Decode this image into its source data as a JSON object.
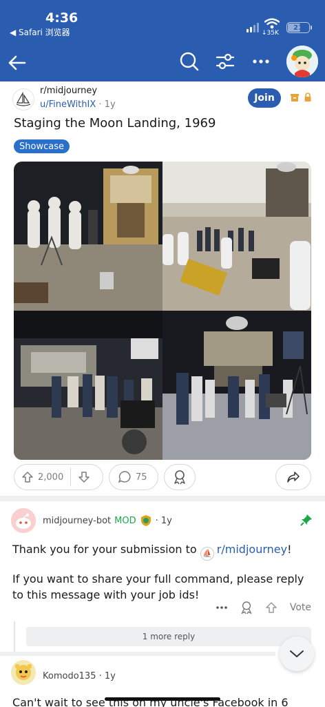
{
  "status_bar": {
    "time": "4:36",
    "back_app": "◀ Safari 浏览器",
    "network_speed": "↓35K",
    "battery": "21"
  },
  "nav": {
    "back_icon": "arrow-left-icon",
    "search_icon": "search-icon",
    "filter_icon": "sliders-icon",
    "more_icon": "ellipsis-icon"
  },
  "post": {
    "subreddit": "r/midjourney",
    "author": "u/FineWithIX",
    "age": "· 1y",
    "join_label": "Join",
    "title": "Staging the Moon Landing, 1969",
    "flair": "Showcase",
    "upvotes": "2,000",
    "comments": "75"
  },
  "comments": [
    {
      "author": "midjourney-bot",
      "mod_label": "MOD",
      "age": "· 1y",
      "body_prefix": "Thank you for your submission to ",
      "sub_link": "r/midjourney",
      "body_suffix": "!",
      "body_2": "If you want to share your full command, please reply to this message with your job ids!",
      "vote_label": "Vote",
      "more_replies": "1 more reply"
    },
    {
      "author": "Komodo135",
      "age": "· 1y",
      "body": "Can't wait to see this on my uncle's Facebook in 6"
    }
  ],
  "colors": {
    "header_blue": "#2a5db0",
    "flair_blue": "#2a6fc9",
    "mod_green": "#1ca84a"
  }
}
